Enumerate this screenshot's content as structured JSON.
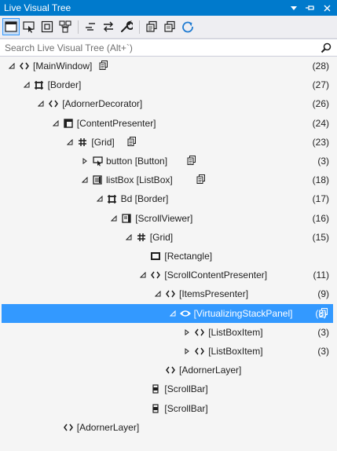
{
  "panel": {
    "title": "Live Visual Tree",
    "controls": [
      "dropdown-arrow-icon",
      "pin-icon",
      "close-icon"
    ]
  },
  "toolbar": {
    "buttons": [
      "select-element-icon",
      "display-layout-adorners-icon",
      "track-focus-icon",
      "preview-selection-icon",
      "show-just-my-xaml-icon",
      "toggle-hierarchy-icon",
      "settings-wrench-icon",
      "show-in-xaml-icon",
      "show-properties-icon",
      "refresh-icon"
    ]
  },
  "search": {
    "placeholder": "Search Live Visual Tree (Alt+`)"
  },
  "colors": {
    "accent": "#007acc",
    "selection": "#3399ff",
    "background": "#f5f5f5"
  },
  "tree": {
    "rows": [
      {
        "label": "[MainWindow]",
        "count": "(28)",
        "icon": "xaml-element-icon",
        "expander": "expanded",
        "xaml_link": true,
        "depth": 0
      },
      {
        "label": "[Border]",
        "count": "(27)",
        "icon": "border-icon",
        "expander": "expanded",
        "xaml_link": false,
        "depth": 1
      },
      {
        "label": "[AdornerDecorator]",
        "count": "(26)",
        "icon": "xaml-element-icon",
        "expander": "expanded",
        "xaml_link": false,
        "depth": 2
      },
      {
        "label": "[ContentPresenter]",
        "count": "(24)",
        "icon": "content-presenter-icon",
        "expander": "expanded",
        "xaml_link": false,
        "depth": 3
      },
      {
        "label": "[Grid]",
        "count": "(23)",
        "icon": "grid-icon",
        "expander": "expanded",
        "xaml_link": true,
        "depth": 4
      },
      {
        "label": "button [Button]",
        "count": "(3)",
        "icon": "button-icon",
        "expander": "collapsed",
        "xaml_link": true,
        "depth": 5
      },
      {
        "label": "listBox [ListBox]",
        "count": "(18)",
        "icon": "listbox-icon",
        "expander": "expanded",
        "xaml_link": true,
        "depth": 5
      },
      {
        "label": "Bd [Border]",
        "count": "(17)",
        "icon": "border-icon",
        "expander": "expanded",
        "xaml_link": false,
        "depth": 6
      },
      {
        "label": "[ScrollViewer]",
        "count": "(16)",
        "icon": "scrollviewer-icon",
        "expander": "expanded",
        "xaml_link": false,
        "depth": 7
      },
      {
        "label": "[Grid]",
        "count": "(15)",
        "icon": "grid-icon",
        "expander": "expanded",
        "xaml_link": false,
        "depth": 8
      },
      {
        "label": "[Rectangle]",
        "count": "",
        "icon": "rectangle-icon",
        "expander": "none",
        "xaml_link": false,
        "depth": 9
      },
      {
        "label": "[ScrollContentPresenter]",
        "count": "(11)",
        "icon": "xaml-element-icon",
        "expander": "expanded",
        "xaml_link": false,
        "depth": 9
      },
      {
        "label": "[ItemsPresenter]",
        "count": "(9)",
        "icon": "xaml-element-icon",
        "expander": "expanded",
        "xaml_link": false,
        "depth": 10
      },
      {
        "label": "[VirtualizingStackPanel]",
        "count": "(8)",
        "icon": "stack-panel-icon",
        "expander": "expanded",
        "xaml_link": true,
        "depth": 11,
        "selected": true
      },
      {
        "label": "[ListBoxItem]",
        "count": "(3)",
        "icon": "xaml-element-icon",
        "expander": "collapsed",
        "xaml_link": false,
        "depth": 12
      },
      {
        "label": "[ListBoxItem]",
        "count": "(3)",
        "icon": "xaml-element-icon",
        "expander": "collapsed",
        "xaml_link": false,
        "depth": 12
      },
      {
        "label": "[AdornerLayer]",
        "count": "",
        "icon": "xaml-element-icon",
        "expander": "none",
        "xaml_link": false,
        "depth": 10
      },
      {
        "label": "[ScrollBar]",
        "count": "",
        "icon": "scrollbar-icon",
        "expander": "none",
        "xaml_link": false,
        "depth": 9
      },
      {
        "label": "[ScrollBar]",
        "count": "",
        "icon": "scrollbar-icon",
        "expander": "none",
        "xaml_link": false,
        "depth": 9
      },
      {
        "label": "[AdornerLayer]",
        "count": "",
        "icon": "xaml-element-icon",
        "expander": "none",
        "xaml_link": false,
        "depth": 3
      }
    ]
  }
}
